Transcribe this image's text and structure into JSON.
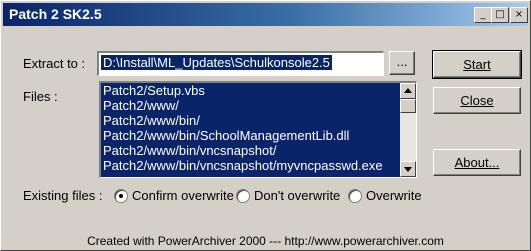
{
  "window": {
    "title": "Patch 2 SK2.5"
  },
  "titlebar_buttons": [
    {
      "name": "minimize",
      "glyph": "_"
    },
    {
      "name": "maximize",
      "glyph": "□"
    },
    {
      "name": "close",
      "glyph": "×"
    }
  ],
  "extract": {
    "label": "Extract to :",
    "value": "D:\\Install\\ML_Updates\\Schulkonsole2.5",
    "browse_label": "..."
  },
  "files": {
    "label": "Files :",
    "items": [
      "Patch2/Setup.vbs",
      "Patch2/www/",
      "Patch2/www/bin/",
      "Patch2/www/bin/SchoolManagementLib.dll",
      "Patch2/www/bin/vncsnapshot/",
      "Patch2/www/bin/vncsnapshot/myvncpasswd.exe"
    ]
  },
  "buttons": {
    "start": "Start",
    "close": "Close",
    "about": "About..."
  },
  "existing": {
    "label": "Existing files :",
    "options": [
      {
        "label": "Confirm overwrite",
        "selected": true
      },
      {
        "label": "Don't overwrite",
        "selected": false
      },
      {
        "label": "Overwrite",
        "selected": false
      }
    ]
  },
  "footer": "Created with PowerArchiver 2000 --- http://www.powerarchiver.com"
}
